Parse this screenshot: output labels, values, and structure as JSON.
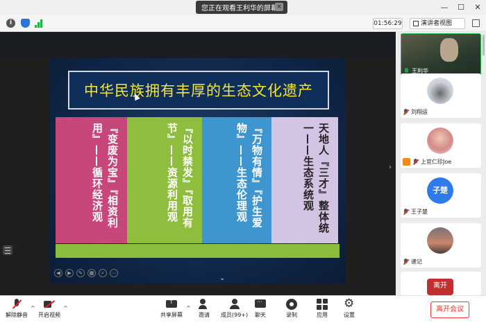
{
  "titlebar": {
    "share_notice": "您正在观看王利华的屏幕",
    "close_glyph": "×",
    "window_controls": [
      "—",
      "☐",
      "✕"
    ]
  },
  "infobar": {
    "timer": "01:56:29",
    "view_mode": "演讲者视图"
  },
  "slide": {
    "title": "中华民族拥有丰厚的生态文化遗产",
    "columns": [
      "『变废为宝』『相资利用』——循环经济观",
      "『以时禁发』『取用有节』——资源利用观",
      "『万物有情』『护生爱物』——生态伦理观",
      "天地人『三才』整体统一——生态系统观"
    ],
    "colors": {
      "col1": "#c7477a",
      "col2": "#8fbe3e",
      "col3": "#3f96cf",
      "col4": "#d4c4e4",
      "title_text": "#f6e634"
    }
  },
  "participants": [
    {
      "name": "王利华",
      "mic": "on",
      "avatar": "video"
    },
    {
      "name": "刘翔运",
      "mic": "muted",
      "avatar": "horse-photo"
    },
    {
      "name": "上官仁珍Joe",
      "mic": "muted",
      "avatar": "girl-photo",
      "host": true
    },
    {
      "name": "王子楚",
      "mic": "muted",
      "avatar": "子楚"
    },
    {
      "name": "速记",
      "mic": "muted",
      "avatar": "sunset-photo"
    },
    {
      "name": "",
      "mic": "muted",
      "avatar": "离开"
    }
  ],
  "toolbar": {
    "unmute": "解除静音",
    "start_video": "开启视频",
    "share_screen": "共享屏幕",
    "invite": "邀请",
    "members": "成员(99+)",
    "chat": "聊天",
    "record": "录制",
    "apps": "应用",
    "settings": "设置",
    "leave": "离开会议"
  }
}
